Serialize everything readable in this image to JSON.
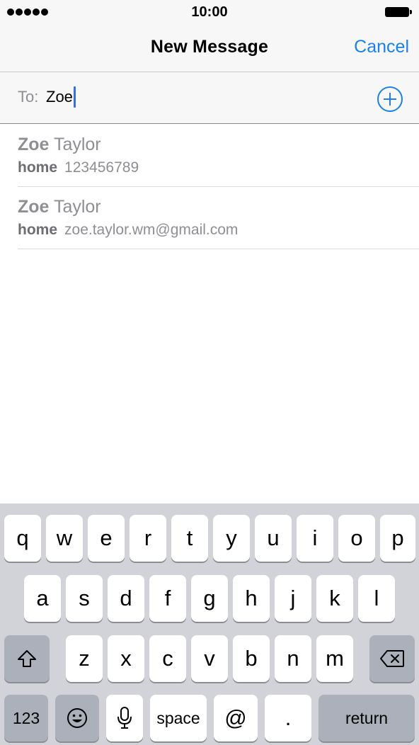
{
  "status_bar": {
    "time": "10:00"
  },
  "nav": {
    "title": "New Message",
    "cancel_label": "Cancel"
  },
  "to_field": {
    "label": "To:",
    "value": "Zoe"
  },
  "suggestions": [
    {
      "name_match": "Zoe",
      "name_rest": " Taylor",
      "type": "home",
      "detail": "123456789"
    },
    {
      "name_match": "Zoe",
      "name_rest": " Taylor",
      "type": "home",
      "detail": "zoe.taylor.wm@gmail.com"
    }
  ],
  "keyboard": {
    "row1": [
      "q",
      "w",
      "e",
      "r",
      "t",
      "y",
      "u",
      "i",
      "o",
      "p"
    ],
    "row2": [
      "a",
      "s",
      "d",
      "f",
      "g",
      "h",
      "j",
      "k",
      "l"
    ],
    "row3": [
      "z",
      "x",
      "c",
      "v",
      "b",
      "n",
      "m"
    ],
    "numbers_label": "123",
    "space_label": "space",
    "at_label": "@",
    "period_label": ".",
    "return_label": "return"
  },
  "colors": {
    "accent": "#1a82e6",
    "caret": "#3b6fd8",
    "keyboard_bg": "#d1d3d9",
    "dark_key": "#abb0ba"
  },
  "icons": [
    "signal-dots-icon",
    "battery-icon",
    "add-contact-icon",
    "shift-icon",
    "backspace-icon",
    "emoji-icon",
    "microphone-icon"
  ]
}
